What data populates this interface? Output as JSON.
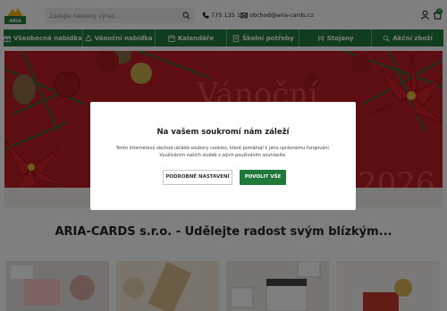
{
  "header": {
    "search_placeholder": "Zadejte hledaný výraz...",
    "phone": "775 135 112",
    "email": "obchod@aria-cards.cz",
    "cart_count": "0"
  },
  "nav": {
    "items": [
      {
        "label": "Všeobecná nabídka",
        "icon": "gift-icon"
      },
      {
        "label": "Vánoční nabídka",
        "icon": "tree-icon"
      },
      {
        "label": "Kalendáře",
        "icon": "calendar-icon"
      },
      {
        "label": "Školní potřeby",
        "icon": "book-icon"
      },
      {
        "label": "Stojany",
        "icon": "stand-icon"
      },
      {
        "label": "Akční zboží",
        "icon": "search-icon"
      }
    ]
  },
  "banner": {
    "text_line": "Vánoční",
    "year": "2026"
  },
  "headline": "ARIA-CARDS s.r.o. - Udělejte radost svým blízkým...",
  "cookie_modal": {
    "title": "Na vašem soukromí nám záleží",
    "text": "Tento internetový obchod ukládá soubory cookies, které pomáhají k jeho správnému fungování. Využíváním našich služeb s jejich používáním souhlasíte.",
    "settings_button": "PODROBNÉ NASTAVENÍ",
    "accept_button": "POVOLIT VŠE"
  },
  "colors": {
    "brand_green": "#1f7a3a",
    "banner_red": "#b81d24"
  }
}
